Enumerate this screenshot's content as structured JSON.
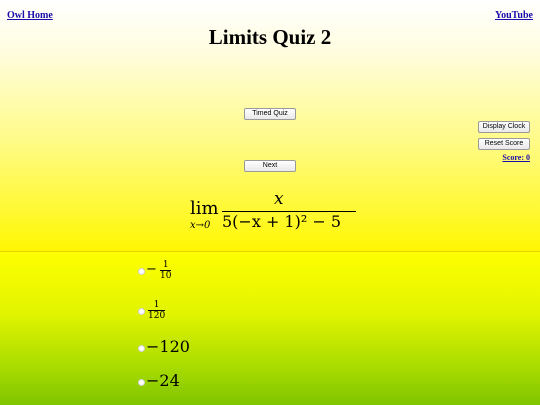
{
  "links": {
    "home": "Owl Home",
    "youtube": "YouTube"
  },
  "title": "Limits Quiz 2",
  "buttons": {
    "timed_quiz": "Timed Quiz",
    "next": "Next",
    "display_clock": "Display Clock",
    "reset_score": "Reset Score"
  },
  "score_text": "Score: 0",
  "problem": {
    "lim": "lim",
    "subscript": "x→0",
    "numerator": "x",
    "denominator": "5(−x + 1)² − 5"
  },
  "options": [
    {
      "sign": "−",
      "numerator": "1",
      "denominator": "10"
    },
    {
      "sign": "",
      "numerator": "1",
      "denominator": "120"
    },
    {
      "value": "−120"
    },
    {
      "value": "−24"
    }
  ]
}
